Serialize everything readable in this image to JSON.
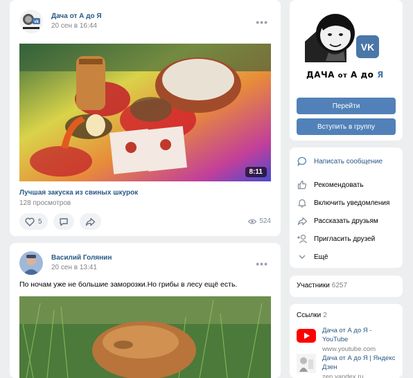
{
  "post1": {
    "author": "Дача от А до Я",
    "date": "20 сен в 16:44",
    "video_duration": "8:11",
    "video_title": "Лучшая закуска из свиных шкурок",
    "video_views": "128 просмотров",
    "likes": "5",
    "views": "524"
  },
  "post2": {
    "author": "Василий Голянин",
    "date": "20 сен в 13:41",
    "text": "По ночам уже не большие заморозки.Но грибы в лесу ещё есть."
  },
  "group": {
    "logo_main": "ДАЧА",
    "logo_ot": "от",
    "logo_a": "А до",
    "logo_ya": "Я",
    "go_button": "Перейти",
    "join_button": "Вступить в группу"
  },
  "menu": {
    "items": [
      {
        "label": "Написать сообщение",
        "icon": "message-icon"
      },
      {
        "label": "Рекомендовать",
        "icon": "thumbs-up-icon"
      },
      {
        "label": "Включить уведомления",
        "icon": "bell-icon"
      },
      {
        "label": "Рассказать друзьям",
        "icon": "share-icon"
      },
      {
        "label": "Пригласить друзей",
        "icon": "add-user-icon"
      },
      {
        "label": "Ещё",
        "icon": "chevron-down-icon"
      }
    ]
  },
  "members": {
    "label": "Участники",
    "count": "6257"
  },
  "links": {
    "label": "Ссылки",
    "count": "2",
    "items": [
      {
        "title": "Дача от А до Я - YouTube",
        "url": "www.youtube.com",
        "icon": "youtube-icon"
      },
      {
        "title": "Дача от А до Я | Яндекс Дзен",
        "url": "zen.yandex.ru",
        "icon": "zen-icon"
      }
    ]
  },
  "colors": {
    "accent": "#5181b8",
    "link": "#2a5885",
    "background": "#edeef0",
    "youtube": "#ff0000"
  }
}
